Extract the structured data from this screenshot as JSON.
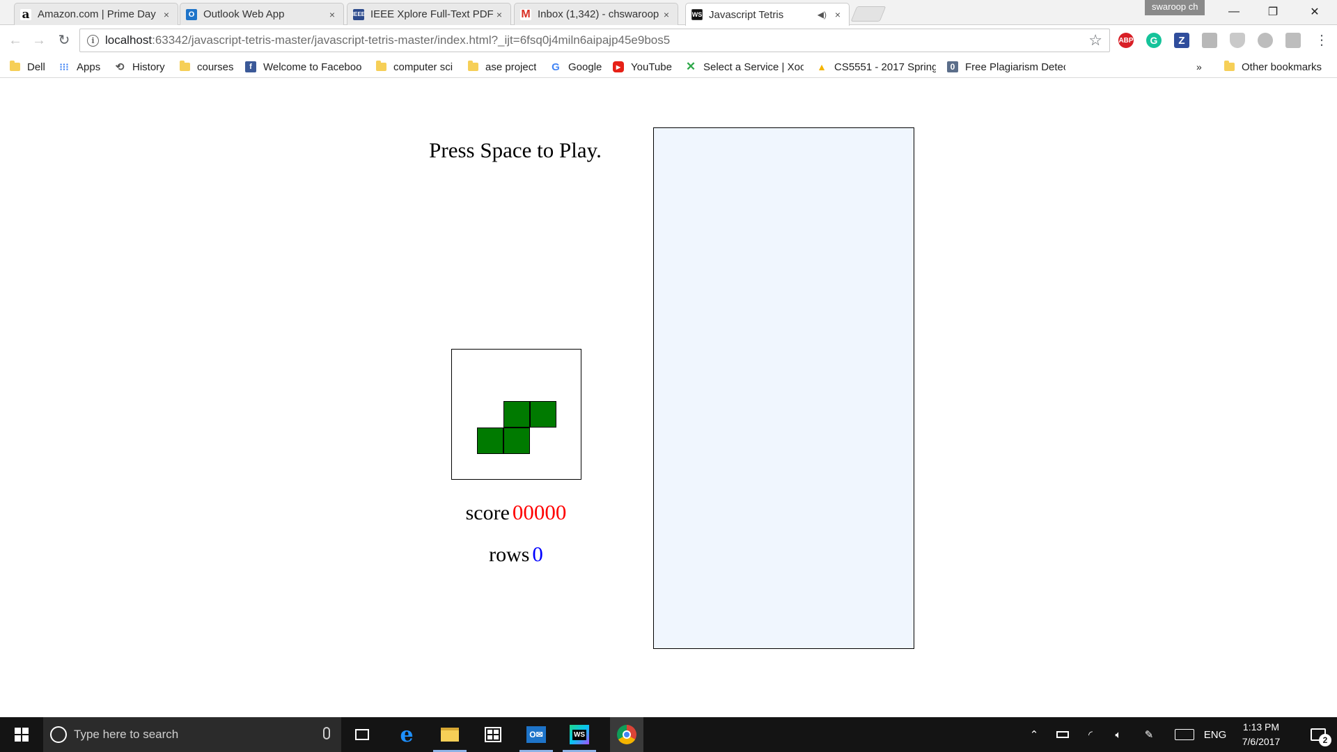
{
  "browser": {
    "tabs": [
      {
        "title": "Amazon.com | Prime Day",
        "favicon": "amazon-icon",
        "close": "×"
      },
      {
        "title": "Outlook Web App",
        "favicon": "outlook-icon",
        "close": "×"
      },
      {
        "title": "IEEE Xplore Full-Text PDF:",
        "favicon": "ieee-icon",
        "close": "×"
      },
      {
        "title": "Inbox (1,342) - chswaroop",
        "favicon": "gmail-icon",
        "close": "×"
      },
      {
        "title": "Javascript Tetris",
        "favicon": "webstorm-icon",
        "close": "×",
        "active": true
      }
    ],
    "profile_name": "swaroop ch",
    "window_controls": {
      "minimize": "—",
      "restore": "❐",
      "close": "✕"
    },
    "address": {
      "host": "localhost",
      "path": ":63342/javascript-tetris-master/javascript-tetris-master/index.html?_ijt=6fsq0j4miln6aipajp45e9bos5"
    },
    "extensions": [
      {
        "name": "adblock-plus-icon",
        "text": "ABP",
        "color": "#d81f26"
      },
      {
        "name": "grammarly-icon",
        "text": "G",
        "color": "#15c39a"
      },
      {
        "name": "zotero-icon",
        "text": "Z",
        "color": "#2f4d9c"
      },
      {
        "name": "translate-icon",
        "text": "",
        "color": "#b8b8b8"
      },
      {
        "name": "shield-extension-icon",
        "text": "",
        "color": "#c9c9c9"
      },
      {
        "name": "drive-extension-icon",
        "text": "",
        "color": "#bdbdbd"
      },
      {
        "name": "pdf-extension-icon",
        "text": "",
        "color": "#bdbdbd"
      }
    ],
    "bookmarks": [
      {
        "label": "Dell",
        "icon": "folder-icon"
      },
      {
        "label": "Apps",
        "icon": "apps-grid-icon"
      },
      {
        "label": "History",
        "icon": "history-icon"
      },
      {
        "label": "courses",
        "icon": "folder-icon"
      },
      {
        "label": "Welcome to Faceboo",
        "icon": "facebook-icon"
      },
      {
        "label": "computer sci",
        "icon": "folder-icon"
      },
      {
        "label": "ase project",
        "icon": "folder-icon"
      },
      {
        "label": "Google",
        "icon": "google-icon"
      },
      {
        "label": "YouTube",
        "icon": "youtube-icon"
      },
      {
        "label": "Select a Service | Xoo",
        "icon": "xoom-icon"
      },
      {
        "label": "CS5551 - 2017 Spring",
        "icon": "google-drive-icon"
      },
      {
        "label": "Free Plagiarism Detec",
        "icon": "plagiarism-icon"
      }
    ],
    "bookmarks_overflow": "»",
    "other_bookmarks": "Other bookmarks"
  },
  "game": {
    "message": "Press Space to Play.",
    "next_piece": "S",
    "piece_color": "#007a00",
    "board_color": "#f0f6fe",
    "score_label": "score",
    "score_value": "00000",
    "score_color": "#ff0000",
    "rows_label": "rows",
    "rows_value": "0",
    "rows_color": "#0000ff"
  },
  "taskbar": {
    "search_placeholder": "Type here to search",
    "apps": [
      "task-view-icon",
      "edge-icon",
      "file-explorer-icon",
      "store-icon",
      "outlook-icon",
      "webstorm-icon",
      "chrome-icon"
    ],
    "language": "ENG",
    "time": "1:13 PM",
    "date": "7/6/2017",
    "notification_count": "2"
  }
}
